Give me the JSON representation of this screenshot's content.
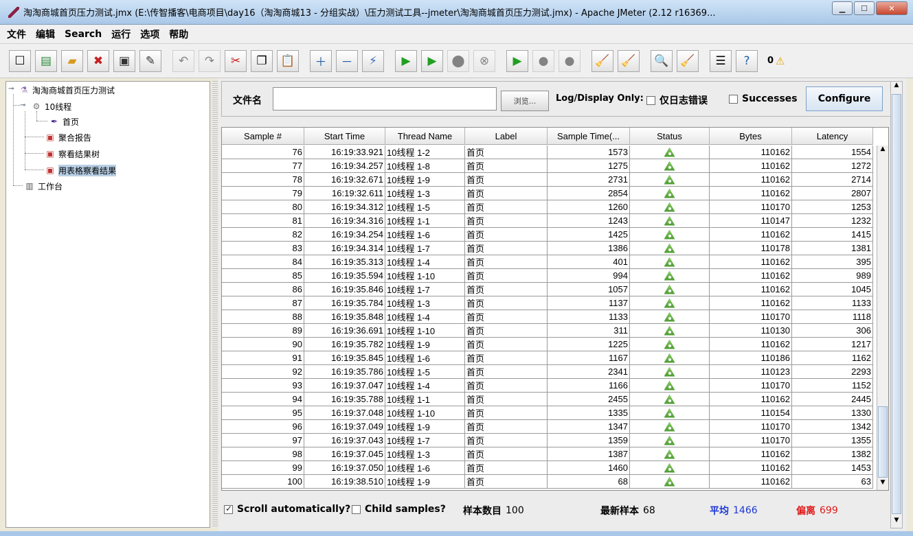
{
  "window": {
    "title": "淘淘商城首页压力测试.jmx (E:\\传智播客\\电商项目\\day16（淘淘商城13 - 分组实战）\\压力测试工具--jmeter\\淘淘商城首页压力测试.jmx) - Apache JMeter (2.12 r16369..."
  },
  "menu": [
    "文件",
    "编辑",
    "Search",
    "运行",
    "选项",
    "帮助"
  ],
  "toolbar": {
    "warning_count": "0"
  },
  "tree": {
    "root": "淘淘商城首页压力测试",
    "thread_group": "10线程",
    "sampler": "首页",
    "listener1": "聚合报告",
    "listener2": "察看结果树",
    "listener3": "用表格察看结果",
    "workbench": "工作台"
  },
  "file_panel": {
    "label": "文件名",
    "value": "",
    "browse": "浏览...",
    "log_display_only": "Log/Display Only:",
    "errors_only": "仅日志错误",
    "successes": "Successes",
    "configure": "Configure"
  },
  "table": {
    "columns": [
      "Sample #",
      "Start Time",
      "Thread Name",
      "Label",
      "Sample Time(...",
      "Status",
      "Bytes",
      "Latency"
    ],
    "rows": [
      [
        "76",
        "16:19:33.921",
        "10线程 1-2",
        "首页",
        "1573",
        "ok",
        "110162",
        "1554"
      ],
      [
        "77",
        "16:19:34.257",
        "10线程 1-8",
        "首页",
        "1275",
        "ok",
        "110162",
        "1272"
      ],
      [
        "78",
        "16:19:32.671",
        "10线程 1-9",
        "首页",
        "2731",
        "ok",
        "110162",
        "2714"
      ],
      [
        "79",
        "16:19:32.611",
        "10线程 1-3",
        "首页",
        "2854",
        "ok",
        "110162",
        "2807"
      ],
      [
        "80",
        "16:19:34.312",
        "10线程 1-5",
        "首页",
        "1260",
        "ok",
        "110170",
        "1253"
      ],
      [
        "81",
        "16:19:34.316",
        "10线程 1-1",
        "首页",
        "1243",
        "ok",
        "110147",
        "1232"
      ],
      [
        "82",
        "16:19:34.254",
        "10线程 1-6",
        "首页",
        "1425",
        "ok",
        "110162",
        "1415"
      ],
      [
        "83",
        "16:19:34.314",
        "10线程 1-7",
        "首页",
        "1386",
        "ok",
        "110178",
        "1381"
      ],
      [
        "84",
        "16:19:35.313",
        "10线程 1-4",
        "首页",
        "401",
        "ok",
        "110162",
        "395"
      ],
      [
        "85",
        "16:19:35.594",
        "10线程 1-10",
        "首页",
        "994",
        "ok",
        "110162",
        "989"
      ],
      [
        "86",
        "16:19:35.846",
        "10线程 1-7",
        "首页",
        "1057",
        "ok",
        "110162",
        "1045"
      ],
      [
        "87",
        "16:19:35.784",
        "10线程 1-3",
        "首页",
        "1137",
        "ok",
        "110162",
        "1133"
      ],
      [
        "88",
        "16:19:35.848",
        "10线程 1-4",
        "首页",
        "1133",
        "ok",
        "110170",
        "1118"
      ],
      [
        "89",
        "16:19:36.691",
        "10线程 1-10",
        "首页",
        "311",
        "ok",
        "110130",
        "306"
      ],
      [
        "90",
        "16:19:35.782",
        "10线程 1-9",
        "首页",
        "1225",
        "ok",
        "110162",
        "1217"
      ],
      [
        "91",
        "16:19:35.845",
        "10线程 1-6",
        "首页",
        "1167",
        "ok",
        "110186",
        "1162"
      ],
      [
        "92",
        "16:19:35.786",
        "10线程 1-5",
        "首页",
        "2341",
        "ok",
        "110123",
        "2293"
      ],
      [
        "93",
        "16:19:37.047",
        "10线程 1-4",
        "首页",
        "1166",
        "ok",
        "110170",
        "1152"
      ],
      [
        "94",
        "16:19:35.788",
        "10线程 1-1",
        "首页",
        "2455",
        "ok",
        "110162",
        "2445"
      ],
      [
        "95",
        "16:19:37.048",
        "10线程 1-10",
        "首页",
        "1335",
        "ok",
        "110154",
        "1330"
      ],
      [
        "96",
        "16:19:37.049",
        "10线程 1-9",
        "首页",
        "1347",
        "ok",
        "110170",
        "1342"
      ],
      [
        "97",
        "16:19:37.043",
        "10线程 1-7",
        "首页",
        "1359",
        "ok",
        "110170",
        "1355"
      ],
      [
        "98",
        "16:19:37.045",
        "10线程 1-3",
        "首页",
        "1387",
        "ok",
        "110162",
        "1382"
      ],
      [
        "99",
        "16:19:37.050",
        "10线程 1-6",
        "首页",
        "1460",
        "ok",
        "110162",
        "1453"
      ],
      [
        "100",
        "16:19:38.510",
        "10线程 1-9",
        "首页",
        "68",
        "ok",
        "110162",
        "63"
      ]
    ]
  },
  "bottom": {
    "scroll_auto": "Scroll automatically?",
    "scroll_auto_checked": true,
    "child_samples": "Child samples?",
    "child_samples_checked": false,
    "sample_count_label": "样本数目",
    "sample_count": "100",
    "latest_label": "最新样本",
    "latest": "68",
    "avg_label": "平均",
    "avg": "1466",
    "dev_label": "偏离",
    "dev": "699"
  },
  "colors": {
    "avg": "#1c37d8",
    "dev": "#e01818",
    "selection": "#b8cfe5",
    "status_ok": "#4a9a30"
  }
}
